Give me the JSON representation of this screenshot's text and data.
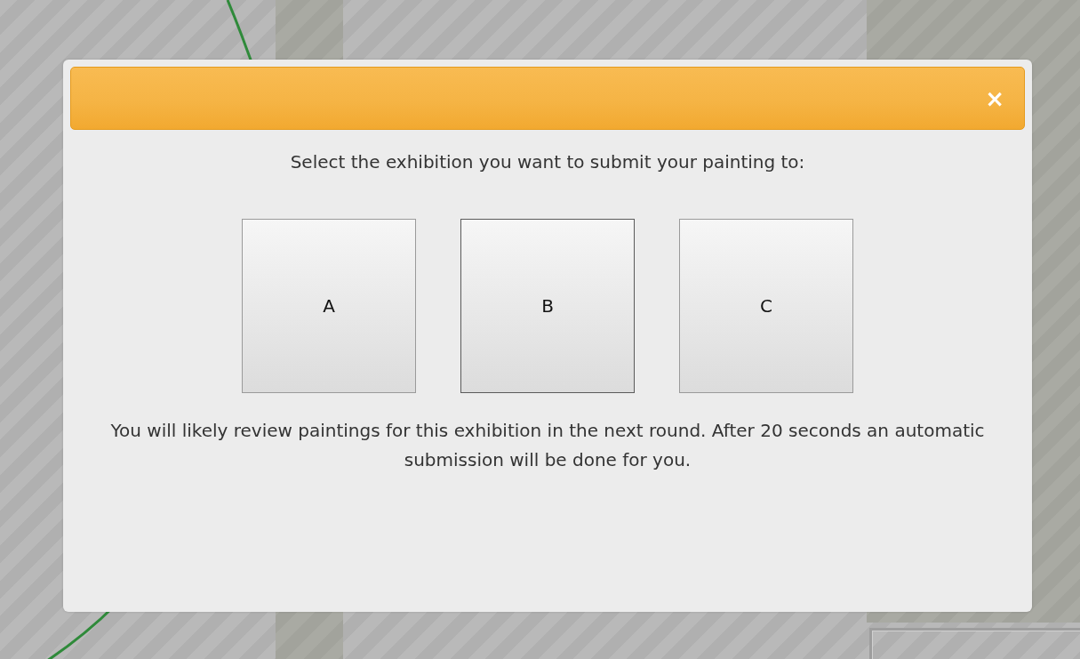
{
  "dialog": {
    "close": "×",
    "prompt": "Select the exhibition you want to submit your painting to:",
    "options": [
      {
        "label": "A",
        "hovered": false
      },
      {
        "label": "B",
        "hovered": true
      },
      {
        "label": "C",
        "hovered": false
      }
    ],
    "note": "You will likely review paintings for this exhibition in the next round. After 20 seconds an automatic submission will be done for you."
  }
}
